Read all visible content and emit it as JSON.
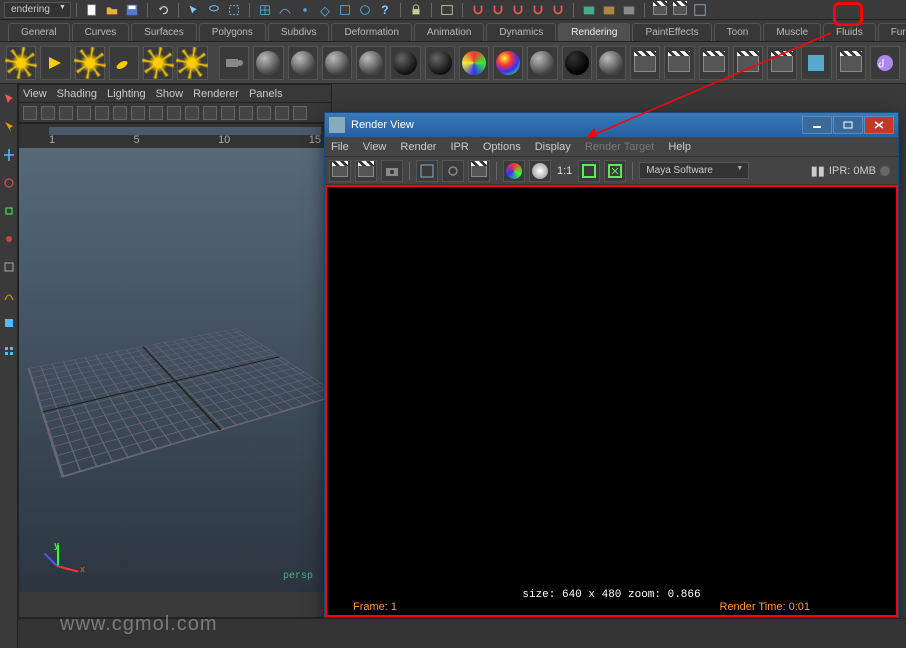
{
  "topbar": {
    "workspace": "endering"
  },
  "module_tabs": [
    "General",
    "Curves",
    "Surfaces",
    "Polygons",
    "Subdivs",
    "Deformation",
    "Animation",
    "Dynamics",
    "Rendering",
    "PaintEffects",
    "Toon",
    "Muscle",
    "Fluids",
    "Fur"
  ],
  "active_module": "Rendering",
  "viewport_menu": [
    "View",
    "Shading",
    "Lighting",
    "Show",
    "Renderer",
    "Panels"
  ],
  "axis_labels": {
    "x": "x",
    "y": "y"
  },
  "camera_label": "persp",
  "timeline_numbers": [
    "1",
    "",
    "5",
    "",
    "",
    "",
    "10",
    "",
    "",
    "",
    "15"
  ],
  "render_view": {
    "title": "Render View",
    "menu": [
      "File",
      "View",
      "Render",
      "IPR",
      "Options",
      "Display",
      "Render Target",
      "Help"
    ],
    "disabled_menu": "Render Target",
    "ratio": "1:1",
    "renderer": "Maya Software",
    "ipr_label": "IPR: 0MB",
    "status_size": "size: 640 x 480 zoom: 0.866",
    "status_frame": "Frame: 1",
    "status_time": "Render Time: 0:01"
  },
  "watermark": "www.cgmol.com"
}
